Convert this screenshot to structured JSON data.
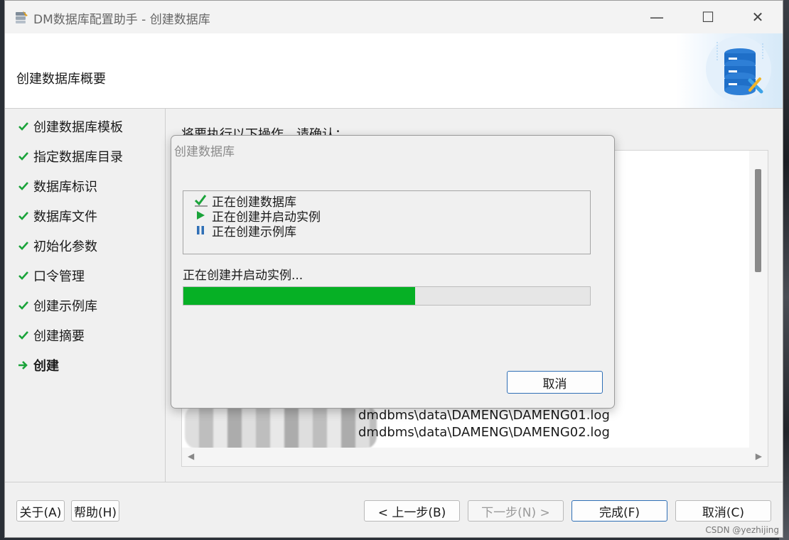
{
  "window": {
    "title": "DM数据库配置助手 - 创建数据库",
    "minimize_glyph": "—",
    "maximize_glyph": "☐",
    "close_glyph": "✕"
  },
  "header": {
    "title": "创建数据库概要"
  },
  "steps": [
    {
      "label": "创建数据库模板",
      "state": "done"
    },
    {
      "label": "指定数据库目录",
      "state": "done"
    },
    {
      "label": "数据库标识",
      "state": "done"
    },
    {
      "label": "数据库文件",
      "state": "done"
    },
    {
      "label": "初始化参数",
      "state": "done"
    },
    {
      "label": "口令管理",
      "state": "done"
    },
    {
      "label": "创建示例库",
      "state": "done"
    },
    {
      "label": "创建摘要",
      "state": "done"
    },
    {
      "label": "创建",
      "state": "current"
    }
  ],
  "content": {
    "confirm_label": "将要执行以下操作，请确认：",
    "log_lines": [
      "dmdbms\\data\\DAMENG\\DAMENG01.log",
      "dmdbms\\data\\DAMENG\\DAMENG02.log"
    ]
  },
  "dialog": {
    "title": "创建数据库",
    "tasks": [
      {
        "label": "正在创建数据库",
        "icon": "check-icon"
      },
      {
        "label": "正在创建并启动实例",
        "icon": "play-icon"
      },
      {
        "label": "正在创建示例库",
        "icon": "pause-icon"
      }
    ],
    "status": "正在创建并启动实例...",
    "progress": 0.57,
    "cancel_label": "取消"
  },
  "footer": {
    "about_label": "关于(A)",
    "help_label": "帮助(H)",
    "back_label": "< 上一步(B)",
    "next_label": "下一步(N) >",
    "finish_label": "完成(F)",
    "cancel_label": "取消(C)"
  },
  "watermark": "CSDN @yezhijing",
  "colors": {
    "progress": "#06b025",
    "check": "#1aa33a",
    "play": "#1aa33a",
    "pause": "#2f6fb6"
  }
}
